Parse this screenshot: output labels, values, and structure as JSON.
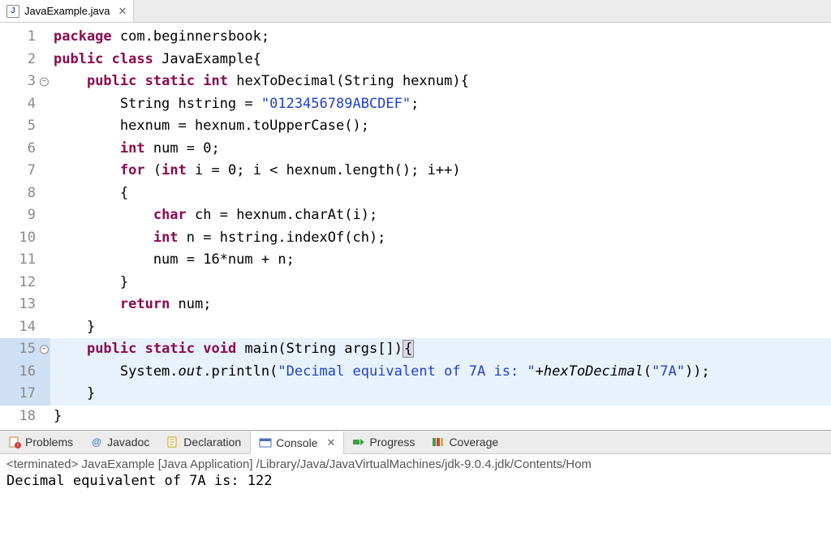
{
  "tab": {
    "filename": "JavaExample.java",
    "close_glyph": "✕"
  },
  "code": {
    "lines": [
      {
        "num": "1",
        "html": "<span class='kw'>package</span> com.beginnersbook;"
      },
      {
        "num": "2",
        "html": "<span class='kw'>public</span> <span class='kw'>class</span> JavaExample{"
      },
      {
        "num": "3",
        "fold": true,
        "html": "    <span class='kw'>public</span> <span class='kw'>static</span> <span class='kw'>int</span> hexToDecimal(String hexnum){"
      },
      {
        "num": "4",
        "html": "        String hstring = <span class='str'>\"0123456789ABCDEF\"</span>;"
      },
      {
        "num": "5",
        "html": "        hexnum = hexnum.toUpperCase();"
      },
      {
        "num": "6",
        "html": "        <span class='kw'>int</span> num = 0;"
      },
      {
        "num": "7",
        "html": "        <span class='kw'>for</span> (<span class='kw'>int</span> i = 0; i &lt; hexnum.length(); i++)"
      },
      {
        "num": "8",
        "html": "        {"
      },
      {
        "num": "9",
        "html": "            <span class='kw'>char</span> ch = hexnum.charAt(i);"
      },
      {
        "num": "10",
        "html": "            <span class='kw'>int</span> n = hstring.indexOf(ch);"
      },
      {
        "num": "11",
        "html": "            num = 16*num + n;"
      },
      {
        "num": "12",
        "html": "        }"
      },
      {
        "num": "13",
        "html": "        <span class='kw'>return</span> num;"
      },
      {
        "num": "14",
        "html": "    }"
      },
      {
        "num": "15",
        "fold": true,
        "hl": true,
        "html": "    <span class='kw'>public</span> <span class='kw'>static</span> <span class='kw'>void</span> main(String args[])<span class='cursor-box'>{</span>"
      },
      {
        "num": "16",
        "hl": true,
        "html": "        System.<span class='italic-static'>out</span>.println(<span class='str'>\"Decimal equivalent of 7A is: \"</span>+<span class='italic-static'>hexToDecimal</span>(<span class='str'>\"7A\"</span>));"
      },
      {
        "num": "17",
        "hl": true,
        "html": "    }"
      },
      {
        "num": "18",
        "html": "}"
      }
    ]
  },
  "bottom_tabs": {
    "problems": "Problems",
    "javadoc": "Javadoc",
    "declaration": "Declaration",
    "console": "Console",
    "progress": "Progress",
    "coverage": "Coverage",
    "close_glyph": "✕"
  },
  "console": {
    "header": "<terminated> JavaExample [Java Application] /Library/Java/JavaVirtualMachines/jdk-9.0.4.jdk/Contents/Hom",
    "output": "Decimal equivalent of 7A is: 122"
  }
}
